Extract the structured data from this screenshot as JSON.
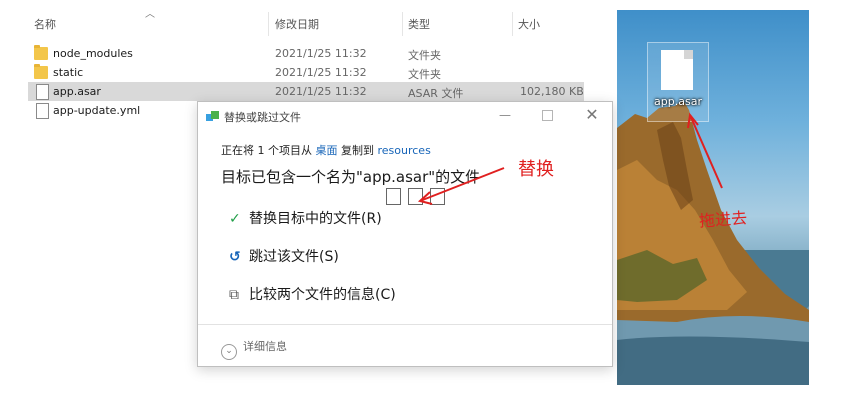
{
  "explorer": {
    "headers": {
      "name": "名称",
      "date": "修改日期",
      "type": "类型",
      "size": "大小"
    },
    "rows": [
      {
        "name": "node_modules",
        "date": "2021/1/25 11:32",
        "type": "文件夹",
        "size": "",
        "icon": "folder-icon"
      },
      {
        "name": "static",
        "date": "2021/1/25 11:32",
        "type": "文件夹",
        "size": "",
        "icon": "folder-icon"
      },
      {
        "name": "app.asar",
        "date": "2021/1/25 11:32",
        "type": "ASAR 文件",
        "size": "102,180 KB",
        "icon": "file-icon",
        "selected": true
      },
      {
        "name": "app-update.yml",
        "date": "",
        "type": "",
        "size": "",
        "icon": "file-icon"
      }
    ]
  },
  "dialog": {
    "title": "替换或跳过文件",
    "copy_line": {
      "prefix": "正在将 1 个项目从 ",
      "source": "桌面",
      "middle": " 复制到 ",
      "destination": "resources"
    },
    "headline": "目标已包含一个名为\"app.asar\"的文件",
    "options": [
      {
        "icon": "checkmark-icon",
        "label": "替换目标中的文件(R)"
      },
      {
        "icon": "skip-icon",
        "label": "跳过该文件(S)"
      },
      {
        "icon": "compare-icon",
        "label": "比较两个文件的信息(C)"
      }
    ],
    "details_label": "详细信息"
  },
  "desktop": {
    "icon_label": "app.asar",
    "drag_note": "拖进去"
  },
  "annotations": {
    "replace_note": "替换",
    "color": "#e02020"
  }
}
